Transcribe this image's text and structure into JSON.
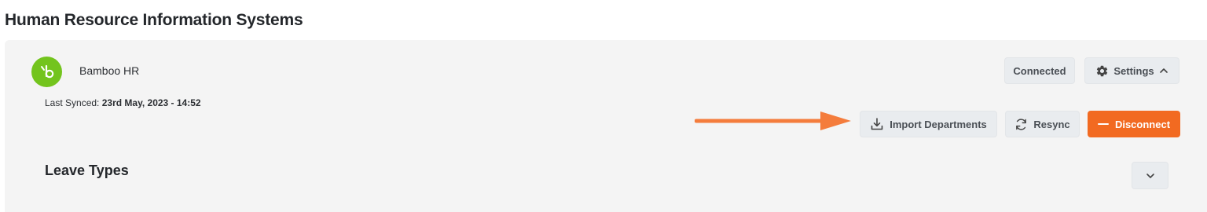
{
  "page": {
    "title": "Human Resource Information Systems"
  },
  "integration": {
    "provider_name": "Bamboo HR",
    "logo_icon": "bamboohr-logo",
    "last_synced_label": "Last Synced:",
    "last_synced_value": "23rd May, 2023 - 14:52",
    "status_label": "Connected",
    "settings_label": "Settings",
    "import_label": "Import Departments",
    "resync_label": "Resync",
    "disconnect_label": "Disconnect"
  },
  "section": {
    "title": "Leave Types"
  },
  "colors": {
    "accent": "#f26a21",
    "logo_green": "#73c41d",
    "annotation_arrow": "#f47c3c"
  }
}
